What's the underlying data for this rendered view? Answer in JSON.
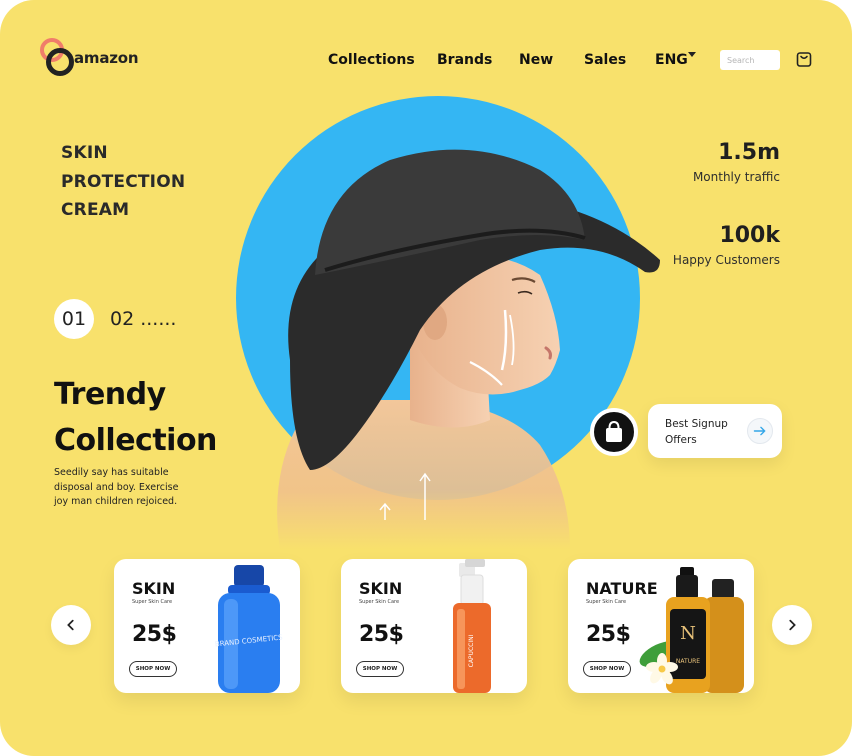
{
  "brand": {
    "name": "amazon"
  },
  "nav": {
    "items": [
      "Collections",
      "Brands",
      "New",
      "Sales"
    ],
    "language": "ENG",
    "search_placeholder": "Search"
  },
  "hero": {
    "product_heading": [
      "SKIN",
      "PROTECTION",
      "CREAM"
    ],
    "pager": {
      "current": "01",
      "next": "02 ......"
    },
    "title": [
      "Trendy",
      "Collection"
    ],
    "description": "Seedily say has suitable disposal and boy. Exercise joy man children rejoiced."
  },
  "stats": [
    {
      "value": "1.5m",
      "label": "Monthly traffic"
    },
    {
      "value": "100k",
      "label": "Happy Customers"
    }
  ],
  "signup": {
    "line1": "Best Signup",
    "line2": "Offers"
  },
  "products": [
    {
      "name": "SKIN",
      "subtitle": "Super Skin Care",
      "price": "25$",
      "button": "SHOP NOW",
      "bottle_text": "BRAND COSMETICS",
      "bottle_color": "#1f6fe0"
    },
    {
      "name": "SKIN",
      "subtitle": "Super Skin Care",
      "price": "25$",
      "button": "SHOP NOW",
      "bottle_text": "CAPUCCINI",
      "bottle_color": "#ec6a2b"
    },
    {
      "name": "NATURE",
      "subtitle": "Super Skin Care",
      "price": "25$",
      "button": "SHOP NOW",
      "bottle_text": "NATURE",
      "bottle_color": "#e8a21f"
    }
  ],
  "colors": {
    "background": "#f8e16c",
    "accent_blue": "#34b6f3",
    "logo_ring": "#f07d6a",
    "text_dark": "#111111"
  },
  "icons": {
    "cart": "shopping-bag-outline-icon",
    "bag": "shopping-bag-icon",
    "arrow": "arrow-right-icon",
    "prev": "chevron-left-icon",
    "next": "chevron-right-icon"
  }
}
